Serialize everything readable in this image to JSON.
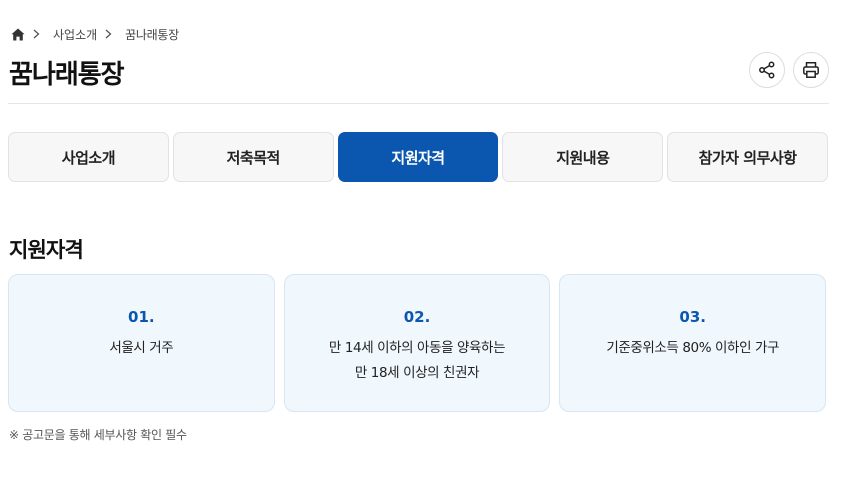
{
  "breadcrumb": {
    "items": [
      "사업소개",
      "꿈나래통장"
    ]
  },
  "page": {
    "title": "꿈나래통장"
  },
  "tabs": [
    {
      "label": "사업소개",
      "active": false
    },
    {
      "label": "저축목적",
      "active": false
    },
    {
      "label": "지원자격",
      "active": true
    },
    {
      "label": "지원내용",
      "active": false
    },
    {
      "label": "참가자 의무사항",
      "active": false
    }
  ],
  "section": {
    "title": "지원자격"
  },
  "cards": [
    {
      "number": "01.",
      "lines": [
        "서울시 거주"
      ]
    },
    {
      "number": "02.",
      "lines": [
        "만 14세 이하의 아동을 양육하는",
        "만 18세 이상의 친권자"
      ]
    },
    {
      "number": "03.",
      "lines": [
        "기준중위소득 80% 이하인 가구"
      ]
    }
  ],
  "note": "※ 공고문을 통해 세부사항 확인 필수",
  "icons": {
    "home": "home-icon",
    "share": "share-icon",
    "print": "print-icon"
  },
  "colors": {
    "accent": "#0b57b0",
    "card_bg": "#f0f7fd",
    "tab_bg": "#f7f7f7"
  }
}
